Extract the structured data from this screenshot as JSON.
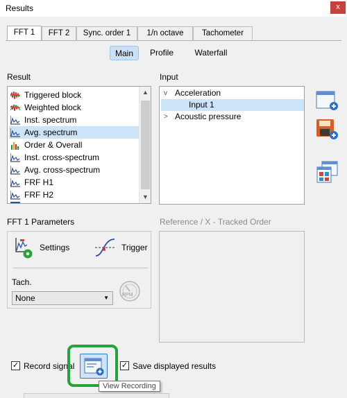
{
  "window": {
    "title": "Results",
    "close_label": "x"
  },
  "tabs": [
    {
      "label": "FFT 1",
      "active": true
    },
    {
      "label": "FFT 2"
    },
    {
      "label": "Sync. order 1"
    },
    {
      "label": "1/n octave"
    },
    {
      "label": "Tachometer"
    }
  ],
  "subtabs": [
    {
      "label": "Main",
      "active": true
    },
    {
      "label": "Profile"
    },
    {
      "label": "Waterfall"
    }
  ],
  "result": {
    "label": "Result",
    "items": [
      {
        "label": "Triggered block",
        "icon": "triggered-block-icon"
      },
      {
        "label": "Weighted block",
        "icon": "weighted-block-icon"
      },
      {
        "label": "Inst. spectrum",
        "icon": "spectrum-icon"
      },
      {
        "label": "Avg. spectrum",
        "icon": "spectrum-icon",
        "selected": true
      },
      {
        "label": "Order & Overall",
        "icon": "order-overall-icon"
      },
      {
        "label": "Inst. cross-spectrum",
        "icon": "spectrum-icon"
      },
      {
        "label": "Avg. cross-spectrum",
        "icon": "spectrum-icon"
      },
      {
        "label": "FRF H1",
        "icon": "spectrum-icon"
      },
      {
        "label": "FRF H2",
        "icon": "spectrum-icon"
      }
    ]
  },
  "input": {
    "label": "Input",
    "tree": [
      {
        "label": "Acceleration",
        "expander": "v"
      },
      {
        "label": "Input 1",
        "selected": true
      },
      {
        "label": "Acoustic pressure",
        "expander": ">"
      }
    ]
  },
  "parameters": {
    "label": "FFT 1 Parameters",
    "settings_label": "Settings",
    "trigger_label": "Trigger",
    "tach_label": "Tach.",
    "tach_value": "None",
    "rpm_label": "RPM"
  },
  "reference": {
    "label": "Reference / X  -  Tracked Order"
  },
  "bottom": {
    "record_signal_label": "Record signal",
    "save_displayed_label": "Save displayed results",
    "tooltip": "View Recording"
  },
  "colors": {
    "selection": "#cce4f7",
    "active_subtab": "#c9e0f7",
    "highlight": "#24a33a",
    "close": "#c8413c"
  }
}
